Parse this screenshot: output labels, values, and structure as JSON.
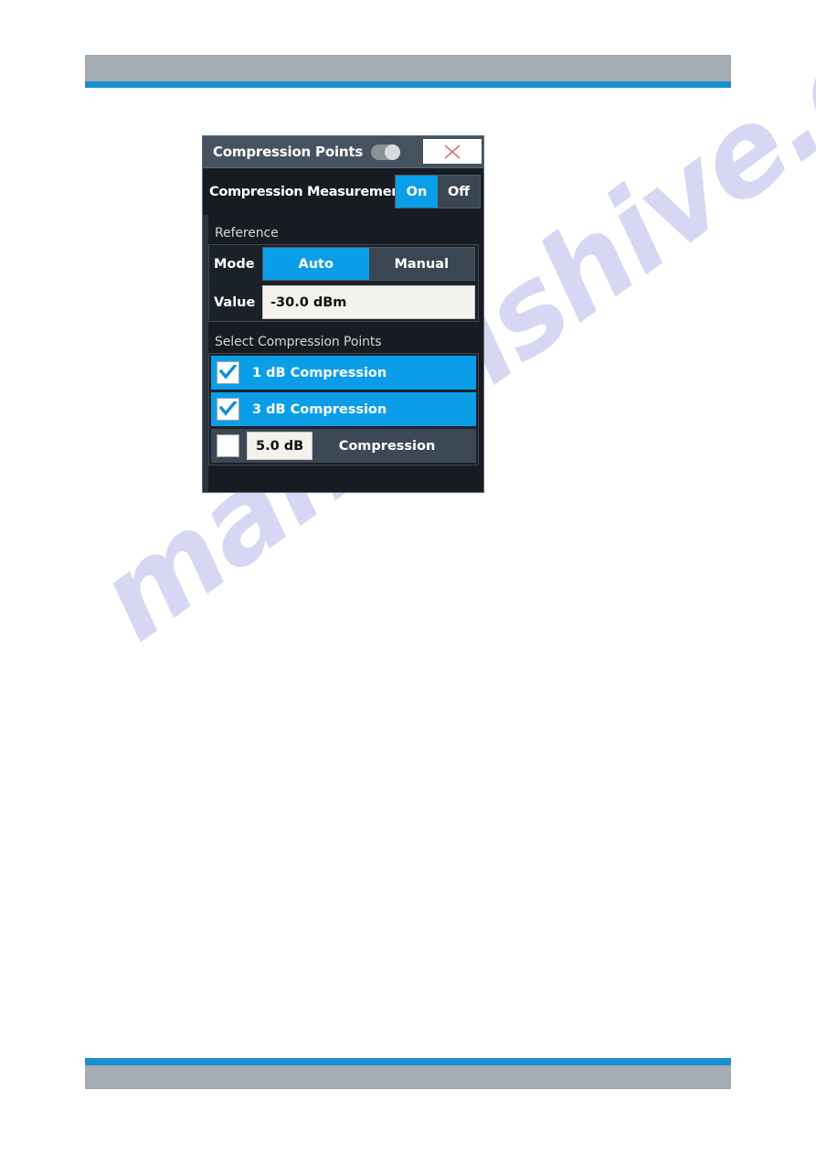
{
  "page": {
    "watermark_text": "manualshive.com",
    "header_bar_color": "#a4abb1",
    "accent_rule_color": "#1a8fd0"
  },
  "dialog": {
    "title": "Compression Points",
    "title_toggle_state": "on",
    "close_icon": "close-x-icon",
    "measurement": {
      "label": "Compression Measurement",
      "options": [
        "On",
        "Off"
      ],
      "selected": "On"
    },
    "reference": {
      "section_label": "Reference",
      "mode": {
        "key": "Mode",
        "options": [
          "Auto",
          "Manual"
        ],
        "selected": "Auto"
      },
      "value": {
        "key": "Value",
        "text": "-30.0 dBm"
      }
    },
    "select_points": {
      "section_label": "Select Compression Points",
      "items": [
        {
          "label": "1 dB Compression",
          "checked": true
        },
        {
          "label": "3 dB Compression",
          "checked": true
        }
      ],
      "custom": {
        "checked": false,
        "value": "5.0 dB",
        "suffix": "Compression"
      }
    },
    "colors": {
      "accent_blue": "#0b9ee8",
      "dialog_bg": "#171c22",
      "titlebar_bg": "#45525f",
      "row_unselected": "#3c4856"
    }
  }
}
